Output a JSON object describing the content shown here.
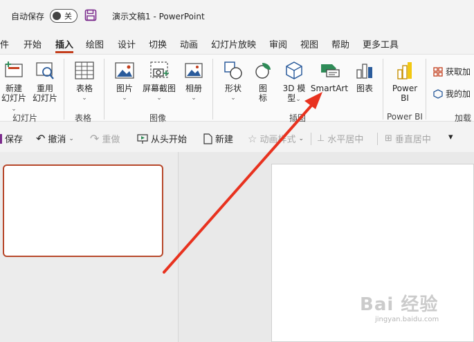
{
  "titlebar": {
    "autosave_label": "自动保存",
    "toggle_state": "关",
    "doc_title": "演示文稿1  -  PowerPoint"
  },
  "tabs": [
    "件",
    "开始",
    "插入",
    "绘图",
    "设计",
    "切换",
    "动画",
    "幻灯片放映",
    "审阅",
    "视图",
    "帮助",
    "更多工具"
  ],
  "active_tab": "插入",
  "ribbon": {
    "new_slide_l1": "新建",
    "new_slide_l2": "幻灯片",
    "reuse_l1": "重用",
    "reuse_l2": "幻灯片",
    "group_slides": "幻灯片",
    "table": "表格",
    "group_table": "表格",
    "pictures": "图片",
    "screenshot": "屏幕截图",
    "album": "相册",
    "group_images": "图像",
    "shapes": "形状",
    "icons_l1": "图",
    "icons_l2": "标",
    "models_l1": "3D 模",
    "models_l2": "型",
    "smartart": "SmartArt",
    "chart": "图表",
    "group_illustrations": "插图",
    "powerbi_l1": "Power",
    "powerbi_l2": "BI",
    "group_powerbi": "Power BI",
    "get_addins": "获取加",
    "my_addins": "我的加",
    "group_addins": "加载"
  },
  "qat": {
    "save": "保存",
    "undo": "撤消",
    "redo": "重做",
    "from_start": "从头开始",
    "new": "新建",
    "anim_style": "动画样式",
    "align_h": "水平居中",
    "align_v": "垂直居中",
    "more": "▾"
  },
  "watermark": {
    "brand": "Bai 经验",
    "url": "jingyan.baidu.com"
  },
  "colors": {
    "accent": "#c43e1c",
    "arrow": "#e8321f",
    "thumb_border": "#b7472a"
  }
}
